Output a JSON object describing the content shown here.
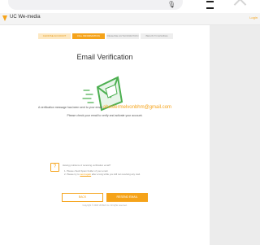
{
  "app": {
    "brand": "UC We-media",
    "login": "Login"
  },
  "steps": [
    {
      "label": "CHOOSE ACCOUNT",
      "state": "done"
    },
    {
      "label": "FILL INFORMATION",
      "state": "active"
    },
    {
      "label": "RELEASE AUTHORIZATION",
      "state": "todo"
    },
    {
      "label": "BEGIN TO ENABLE",
      "state": "todo"
    }
  ],
  "page": {
    "title": "Email Verification",
    "message_prefix": "A verification message has been sent to your email",
    "email": "aheslermelvonbhm@gmail.com",
    "message_suffix": "Please check your email to verify and activate your account."
  },
  "help": {
    "title": "Having problems of receiving verification email?",
    "line1": "1. Please check Spam Folder of your email.",
    "line2_prefix": "2. Please try to",
    "line2_link": "send again",
    "line2_suffix": "after a long while you still not receiving any mail."
  },
  "buttons": {
    "back": "BACK",
    "resend": "RESEND EMAIL"
  },
  "footer": {
    "copyright": "Copyright © 2018 UCWeb Inc. All rights reserved."
  },
  "colors": {
    "accent": "#f5a31a",
    "envelope": "#4caf50"
  }
}
